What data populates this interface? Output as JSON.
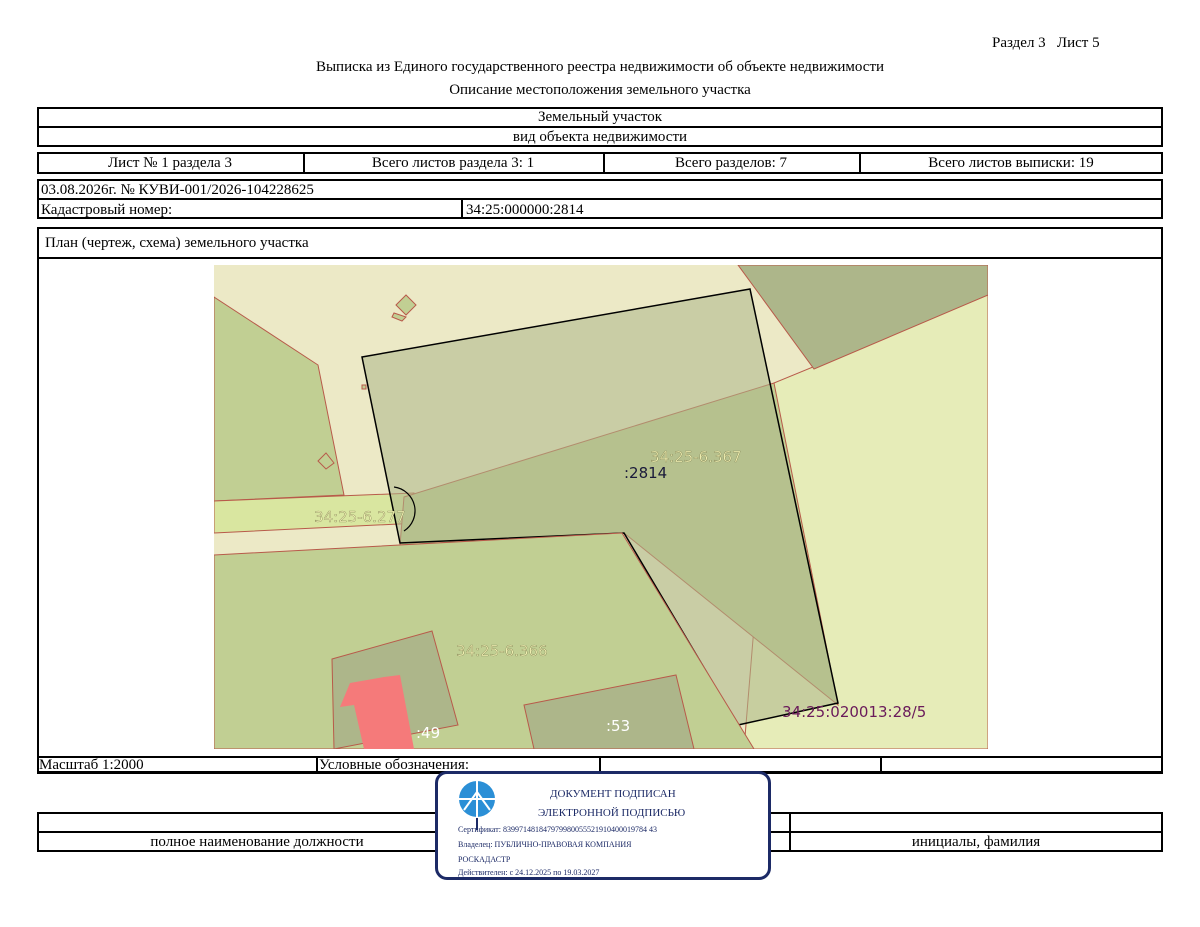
{
  "header": {
    "section_sheet": "Раздел 3   Лист 5",
    "title": "Выписка из Единого государственного реестра недвижимости об объекте недвижимости",
    "subtitle": "Описание местоположения земельного участка"
  },
  "object": {
    "type_value": "Земельный участок",
    "type_caption": "вид объекта недвижимости"
  },
  "sheet_info": {
    "sheet_of_section": "Лист № 1 раздела 3",
    "total_sheets_section": "Всего листов раздела 3: 1",
    "total_sections": "Всего разделов: 7",
    "total_sheets_extract": "Всего листов выписки: 19"
  },
  "record": {
    "date_number": "03.08.2026г. № КУВИ-001/2026-104228625",
    "cadastral_label": "Кадастровый номер:",
    "cadastral_value": "34:25:000000:2814"
  },
  "plan": {
    "title": "План (чертеж, схема) земельного участка",
    "labels": {
      "zone_367": "34:25-6.367",
      "parcel_2814": ":2814",
      "zone_277": "34:25-6.277",
      "zone_366": "34:25-6.366",
      "parcel_53": ":53",
      "parcel_49": ":49",
      "parcel_28_5": "34:25:020013:28/5"
    },
    "colors": {
      "background": "#ece9c6",
      "main_parcel": "#adb68a",
      "zone_green": "#c1cf93",
      "light_green": "#e6ecb8",
      "building": "#f57a7a",
      "boundary_red": "#b85a4a"
    }
  },
  "legend": {
    "scale": "Масштаб 1:2000",
    "legend_label": "Условные обозначения:"
  },
  "signature": {
    "position_caption": "полное наименование должности",
    "name_caption": "инициалы, фамилия"
  },
  "stamp": {
    "line1": "ДОКУМЕНТ ПОДПИСАН",
    "line2": "ЭЛЕКТРОННОЙ ПОДПИСЬЮ",
    "certificate": "Сертификат: 839971481847979980055521910400019784 43",
    "owner": "Владелец: ПУБЛИЧНО-ПРАВОВАЯ КОМПАНИЯ",
    "owner2": "РОСКАДАСТР",
    "validity": "Действителен: с 24.12.2025 по 19.03.2027",
    "logo_icon": "roscadastr-logo-icon"
  }
}
